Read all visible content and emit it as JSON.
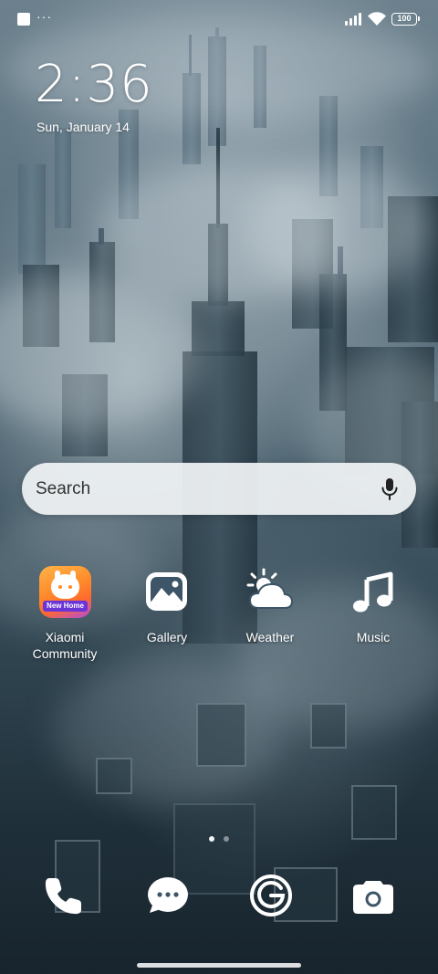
{
  "status_bar": {
    "notification_dots": "···",
    "battery_level": "100",
    "icons": [
      "notification-square-icon",
      "signal-icon",
      "wifi-icon",
      "battery-icon"
    ]
  },
  "clock_widget": {
    "time": "2:36",
    "date": "Sun, January 14"
  },
  "search_bar": {
    "placeholder": "Search",
    "icon": "microphone-icon"
  },
  "apps": [
    {
      "label": "Xiaomi\nCommunity",
      "icon": "xiaomi-community-icon",
      "badge_text": "New Home"
    },
    {
      "label": "Gallery",
      "icon": "gallery-icon"
    },
    {
      "label": "Weather",
      "icon": "weather-icon"
    },
    {
      "label": "Music",
      "icon": "music-icon"
    }
  ],
  "page_indicator": {
    "pages": 2,
    "current": 2
  },
  "dock": [
    {
      "name": "Phone",
      "icon": "phone-icon"
    },
    {
      "name": "Messages",
      "icon": "messages-icon"
    },
    {
      "name": "Browser",
      "icon": "browser-g-icon"
    },
    {
      "name": "Camera",
      "icon": "camera-icon"
    }
  ],
  "colors": {
    "xiaomi_gradient_start": "#ffb347",
    "xiaomi_gradient_end": "#b14be0",
    "xiaomi_banner": "#6a34d9",
    "search_bar_bg": "#f0f3f5"
  }
}
